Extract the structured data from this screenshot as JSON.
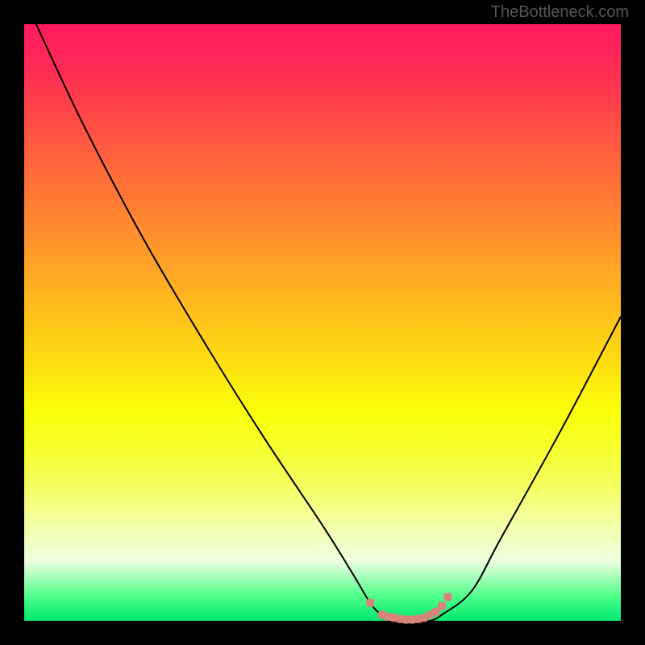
{
  "watermark": "TheBottleneck.com",
  "chart_data": {
    "type": "line",
    "title": "",
    "xlabel": "",
    "ylabel": "",
    "xlim": [
      0,
      100
    ],
    "ylim": [
      0,
      100
    ],
    "series": [
      {
        "name": "bottleneck-curve",
        "x": [
          2,
          10,
          20,
          30,
          40,
          50,
          55,
          58,
          60,
          63,
          65,
          68,
          70,
          75,
          80,
          90,
          100
        ],
        "y": [
          100,
          83,
          64,
          47,
          31,
          16,
          8,
          3,
          1,
          0,
          0,
          0,
          1,
          5,
          14,
          32,
          51
        ]
      }
    ],
    "markers": {
      "name": "valley-markers",
      "color": "#d9837b",
      "x": [
        58,
        60,
        61,
        62,
        63,
        64,
        65,
        66,
        67,
        68,
        69,
        70,
        71
      ],
      "y": [
        3,
        1,
        0.7,
        0.5,
        0.3,
        0.2,
        0.2,
        0.3,
        0.5,
        1.0,
        1.5,
        2.5,
        4
      ]
    },
    "gradient_stops": [
      {
        "pos": 0,
        "color": "#ff1a5e"
      },
      {
        "pos": 50,
        "color": "#ffd713"
      },
      {
        "pos": 90,
        "color": "#eeffe0"
      },
      {
        "pos": 100,
        "color": "#00e870"
      }
    ]
  }
}
